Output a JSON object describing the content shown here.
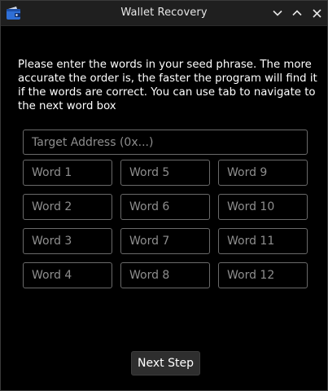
{
  "window": {
    "title": "Wallet Recovery",
    "icon": "wallet-icon",
    "controls": [
      "chevron-down-icon",
      "chevron-up-icon",
      "close-icon"
    ]
  },
  "instructions": "Please enter the words in your seed phrase. The more accurate the order is, the faster the program will find it if the words are correct. You can use tab to navigate to the next word box",
  "target_address": {
    "placeholder": "Target Address (0x...)",
    "value": ""
  },
  "words": {
    "w1": "Word 1",
    "w2": "Word 2",
    "w3": "Word 3",
    "w4": "Word 4",
    "w5": "Word 5",
    "w6": "Word 6",
    "w7": "Word 7",
    "w8": "Word 8",
    "w9": "Word 9",
    "w10": "Word 10",
    "w11": "Word 11",
    "w12": "Word 12"
  },
  "next_button": "Next Step",
  "colors": {
    "background": "#000000",
    "titlebar": "#1f1f1f",
    "field_border": "#6a6a6a",
    "placeholder": "#8e8e8e",
    "button_bg": "#2e2e2e",
    "icon_blue": "#2f6fd6"
  }
}
